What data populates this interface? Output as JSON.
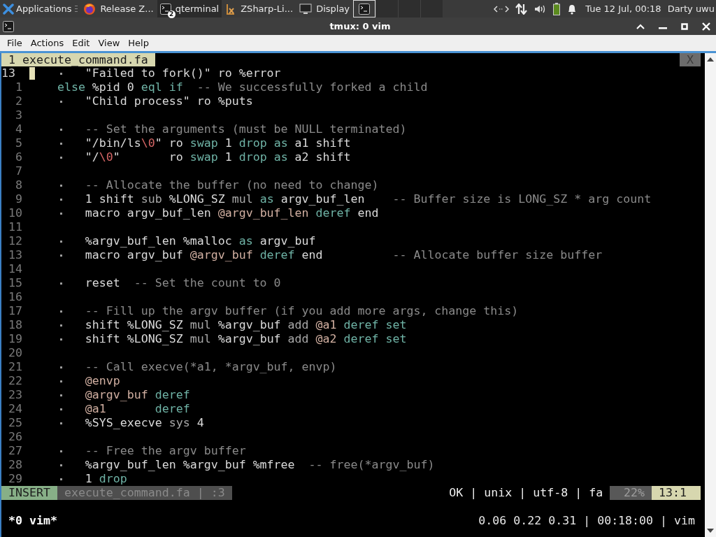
{
  "taskbar": {
    "menu": {
      "label": "Applications"
    },
    "tasks": [
      {
        "kind": "browser",
        "label": "Release Z...",
        "selected": false
      },
      {
        "kind": "terminal",
        "label": "qterminal",
        "badge": "2",
        "selected": true
      },
      {
        "kind": "document",
        "label": "ZSharp-Li...",
        "selected": false
      },
      {
        "kind": "display",
        "label": "Display",
        "selected": false
      }
    ],
    "workspaces": [
      {
        "selected": true,
        "has_window": true
      },
      {
        "selected": false,
        "has_window": false
      },
      {
        "selected": false,
        "has_window": false
      },
      {
        "selected": false,
        "has_window": false
      }
    ],
    "clock": "Tue 12 Jul, 00:18",
    "user": "Darty uwu"
  },
  "window": {
    "title": "tmux: 0 vim"
  },
  "menu": [
    "File",
    "Actions",
    "Edit",
    "View",
    "Help"
  ],
  "vim": {
    "tabs": [
      {
        "label": "1 execute_command.fa",
        "selected": true
      }
    ],
    "close": "X",
    "lines": [
      {
        "number": "13",
        "current": true,
        "cursor": true,
        "indent_guide": true,
        "tokens": [
          {
            "kind": "plain",
            "text": "\"Failed to fork()\" ro %error"
          }
        ]
      },
      {
        "number": "1",
        "current": false,
        "cursor": false,
        "indent_guide": false,
        "tokens": [
          {
            "kind": "keyword",
            "text": "else"
          },
          {
            "kind": "plain",
            "text": " %pid 0 "
          },
          {
            "kind": "keyword",
            "text": "eql if"
          },
          {
            "kind": "comment",
            "text": "  -- We successfully forked a child"
          }
        ]
      },
      {
        "number": "2",
        "current": false,
        "cursor": false,
        "indent_guide": true,
        "tokens": [
          {
            "kind": "plain",
            "text": "\"Child process\" ro %puts"
          }
        ]
      },
      {
        "number": "3",
        "current": false,
        "cursor": false,
        "indent_guide": false
      },
      {
        "number": "4",
        "current": false,
        "cursor": false,
        "indent_guide": true,
        "tokens": [
          {
            "kind": "comment",
            "text": "-- Set the arguments (must be NULL terminated)"
          }
        ]
      },
      {
        "number": "5",
        "current": false,
        "cursor": false,
        "indent_guide": true,
        "tokens": [
          {
            "kind": "plain",
            "text": "\"/bin/ls"
          },
          {
            "kind": "escape",
            "text": "\\0"
          },
          {
            "kind": "plain",
            "text": "\" ro "
          },
          {
            "kind": "keyword",
            "text": "swap"
          },
          {
            "kind": "plain",
            "text": " 1 "
          },
          {
            "kind": "keyword",
            "text": "drop as"
          },
          {
            "kind": "plain",
            "text": " a1 shift"
          }
        ]
      },
      {
        "number": "6",
        "current": false,
        "cursor": false,
        "indent_guide": true,
        "tokens": [
          {
            "kind": "plain",
            "text": "\"/"
          },
          {
            "kind": "escape",
            "text": "\\0"
          },
          {
            "kind": "plain",
            "text": "\"       ro "
          },
          {
            "kind": "keyword",
            "text": "swap"
          },
          {
            "kind": "plain",
            "text": " 1 "
          },
          {
            "kind": "keyword",
            "text": "drop as"
          },
          {
            "kind": "plain",
            "text": " a2 shift"
          }
        ]
      },
      {
        "number": "7",
        "current": false,
        "cursor": false,
        "indent_guide": false
      },
      {
        "number": "8",
        "current": false,
        "cursor": false,
        "indent_guide": true,
        "tokens": [
          {
            "kind": "comment",
            "text": "-- Allocate the buffer (no need to change)"
          }
        ]
      },
      {
        "number": "9",
        "current": false,
        "cursor": false,
        "indent_guide": true,
        "tokens": [
          {
            "kind": "plain",
            "text": "1 shift "
          },
          {
            "kind": "op",
            "text": "sub"
          },
          {
            "kind": "plain",
            "text": " %LONG_SZ "
          },
          {
            "kind": "op",
            "text": "mul"
          },
          {
            "kind": "keyword",
            "text": " as"
          },
          {
            "kind": "plain",
            "text": " argv_buf_len"
          },
          {
            "kind": "comment",
            "text": "    -- Buffer size is LONG_SZ * arg count"
          }
        ]
      },
      {
        "number": "10",
        "current": false,
        "cursor": false,
        "indent_guide": true,
        "tokens": [
          {
            "kind": "plain",
            "text": "macro argv_buf_len "
          },
          {
            "kind": "ref",
            "text": "@argv_buf_len"
          },
          {
            "kind": "keyword",
            "text": " deref"
          },
          {
            "kind": "plain",
            "text": " end"
          }
        ]
      },
      {
        "number": "11",
        "current": false,
        "cursor": false,
        "indent_guide": false
      },
      {
        "number": "12",
        "current": false,
        "cursor": false,
        "indent_guide": true,
        "tokens": [
          {
            "kind": "plain",
            "text": "%argv_buf_len %malloc "
          },
          {
            "kind": "keyword",
            "text": "as"
          },
          {
            "kind": "plain",
            "text": " argv_buf"
          }
        ]
      },
      {
        "number": "13",
        "current": false,
        "cursor": false,
        "indent_guide": true,
        "tokens": [
          {
            "kind": "plain",
            "text": "macro argv_buf "
          },
          {
            "kind": "ref",
            "text": "@argv_buf"
          },
          {
            "kind": "keyword",
            "text": " deref"
          },
          {
            "kind": "plain",
            "text": " end"
          },
          {
            "kind": "comment",
            "text": "          -- Allocate buffer size buffer"
          }
        ]
      },
      {
        "number": "14",
        "current": false,
        "cursor": false,
        "indent_guide": false
      },
      {
        "number": "15",
        "current": false,
        "cursor": false,
        "indent_guide": true,
        "tokens": [
          {
            "kind": "plain",
            "text": "reset"
          },
          {
            "kind": "comment",
            "text": "  -- Set the count to 0"
          }
        ]
      },
      {
        "number": "16",
        "current": false,
        "cursor": false,
        "indent_guide": false
      },
      {
        "number": "17",
        "current": false,
        "cursor": false,
        "indent_guide": true,
        "tokens": [
          {
            "kind": "comment",
            "text": "-- Fill up the argv buffer (if you add more args, change this)"
          }
        ]
      },
      {
        "number": "18",
        "current": false,
        "cursor": false,
        "indent_guide": true,
        "tokens": [
          {
            "kind": "plain",
            "text": "shift %LONG_SZ "
          },
          {
            "kind": "op",
            "text": "mul"
          },
          {
            "kind": "plain",
            "text": " %argv_buf "
          },
          {
            "kind": "op",
            "text": "add"
          },
          {
            "kind": "ref",
            "text": " @a1"
          },
          {
            "kind": "keyword",
            "text": " deref set"
          }
        ]
      },
      {
        "number": "19",
        "current": false,
        "cursor": false,
        "indent_guide": true,
        "tokens": [
          {
            "kind": "plain",
            "text": "shift %LONG_SZ "
          },
          {
            "kind": "op",
            "text": "mul"
          },
          {
            "kind": "plain",
            "text": " %argv_buf "
          },
          {
            "kind": "op",
            "text": "add"
          },
          {
            "kind": "ref",
            "text": " @a2"
          },
          {
            "kind": "keyword",
            "text": " deref set"
          }
        ]
      },
      {
        "number": "20",
        "current": false,
        "cursor": false,
        "indent_guide": false
      },
      {
        "number": "21",
        "current": false,
        "cursor": false,
        "indent_guide": true,
        "tokens": [
          {
            "kind": "comment",
            "text": "-- Call execve(*a1, *argv_buf, envp)"
          }
        ]
      },
      {
        "number": "22",
        "current": false,
        "cursor": false,
        "indent_guide": true,
        "tokens": [
          {
            "kind": "ref",
            "text": "@envp"
          }
        ]
      },
      {
        "number": "23",
        "current": false,
        "cursor": false,
        "indent_guide": true,
        "tokens": [
          {
            "kind": "ref",
            "text": "@argv_buf"
          },
          {
            "kind": "keyword",
            "text": " deref"
          }
        ]
      },
      {
        "number": "24",
        "current": false,
        "cursor": false,
        "indent_guide": true,
        "tokens": [
          {
            "kind": "ref",
            "text": "@a1"
          },
          {
            "kind": "keyword",
            "text": "       deref"
          }
        ]
      },
      {
        "number": "25",
        "current": false,
        "cursor": false,
        "indent_guide": true,
        "tokens": [
          {
            "kind": "plain",
            "text": "%SYS_execve "
          },
          {
            "kind": "op",
            "text": "sys"
          },
          {
            "kind": "plain",
            "text": " 4"
          }
        ]
      },
      {
        "number": "26",
        "current": false,
        "cursor": false,
        "indent_guide": false
      },
      {
        "number": "27",
        "current": false,
        "cursor": false,
        "indent_guide": true,
        "tokens": [
          {
            "kind": "comment",
            "text": "-- Free the argv buffer"
          }
        ]
      },
      {
        "number": "28",
        "current": false,
        "cursor": false,
        "indent_guide": true,
        "tokens": [
          {
            "kind": "plain",
            "text": "%argv_buf_len %argv_buf %mfree"
          },
          {
            "kind": "comment",
            "text": "  -- free(*argv_buf)"
          }
        ]
      },
      {
        "number": "29",
        "current": false,
        "cursor": false,
        "indent_guide": true,
        "tokens": [
          {
            "kind": "plain",
            "text": "1 "
          },
          {
            "kind": "keyword",
            "text": "drop"
          }
        ]
      }
    ],
    "status": {
      "mode": "INSERT",
      "file": "execute_command.fa | :3",
      "info": "OK | unix | utf-8 | fa",
      "percent": "22%",
      "position": "13:1"
    }
  },
  "tmux": {
    "left": "*0 vim*",
    "right": "0.06 0.22 0.31 | 00:18:00 | vim"
  }
}
